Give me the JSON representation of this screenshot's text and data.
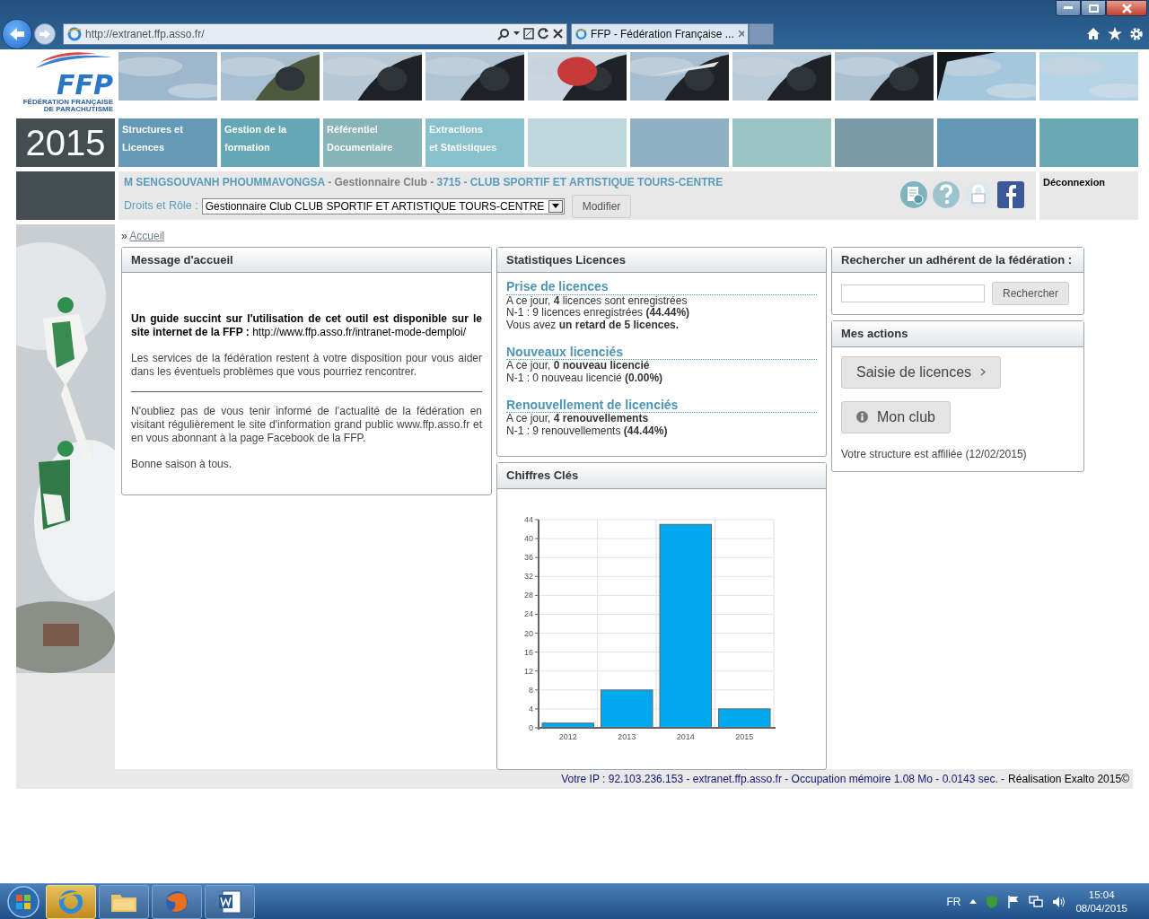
{
  "browser": {
    "address": "http://extranet.ffp.asso.fr/",
    "tab_title": "FFP - Fédération Française ..."
  },
  "header": {
    "logo_letters": "FFP",
    "logo_subtitle": [
      "FÉDÉRATION FRANÇAISE",
      "DE PARACHUTISME"
    ],
    "year": "2015"
  },
  "nav_tiles": [
    {
      "lines": [
        "Structures et",
        "Licences"
      ],
      "color": "#6699b5"
    },
    {
      "lines": [
        "Gestion de la",
        "formation"
      ],
      "color": "#66a7b5"
    },
    {
      "lines": [
        "Référentiel",
        "Documentaire"
      ],
      "color": "#88b3b7"
    },
    {
      "lines": [
        "Extractions",
        "et Statistiques"
      ],
      "color": "#88c0cc"
    },
    {
      "color": "#bed7da"
    },
    {
      "color": "#8fb0c0"
    },
    {
      "color": "#99c4c2"
    },
    {
      "color": "#7b9aa8"
    },
    {
      "color": "#6598b6"
    },
    {
      "color": "#68a9b3"
    }
  ],
  "user_bar": {
    "name": "M SENGSOUVANH PHOUMMAVONGSA",
    "role": "- Gestionnaire Club -",
    "club": "3715 - CLUB SPORTIF ET ARTISTIQUE TOURS-CENTRE",
    "rights_label": "Droits et Rôle :",
    "rights_value": "Gestionnaire Club CLUB SPORTIF ET ARTISTIQUE TOURS-CENTRE",
    "modify_button": "Modifier",
    "logout": "Déconnexion"
  },
  "breadcrumb": {
    "separator": "»",
    "items": [
      "Accueil"
    ]
  },
  "welcome_panel": {
    "title": "Message d'accueil",
    "blocks": [
      {
        "kind": "text",
        "text": "**Un guide succint sur l'utilisation de cet outil est disponible sur le site internet de la FFP :** http://www.ffp.asso.fr/intranet-mode-demploi/"
      },
      {
        "kind": "text",
        "text": "Les services de la fédération restent à votre disposition pour vous aider dans les éventuels problèmes que vous pourriez rencontrer."
      },
      {
        "kind": "divider"
      },
      {
        "kind": "text",
        "text": "N'oubliez pas de vous tenir informé de l’actualité de la fédération en visitant régulièrement le site d'information grand public www.ffp.asso.fr  et en vous abonnant à la page Facebook de la FFP."
      },
      {
        "kind": "text",
        "text": "Bonne saison à tous."
      }
    ]
  },
  "stats_panel": {
    "title": "Statistiques Licences",
    "sections": [
      {
        "title": "Prise de licences",
        "lines": [
          "A ce jour, **4** licences sont enregistrées",
          "N-1 : 9 licences enregistrées **(44.44%)**",
          "Vous avez **un retard de 5 licences.**"
        ]
      },
      {
        "title": "Nouveaux licenciés",
        "lines": [
          "A ce jour, **0 nouveau licencié**",
          "N-1 : 0 nouveau licencié **(0.00%)**"
        ]
      },
      {
        "title": "Renouvellement de licenciés",
        "lines": [
          "A ce jour, **4 renouvellements**",
          "N-1 : 9 renouvellements **(44.44%)**"
        ]
      }
    ]
  },
  "chart_panel": {
    "title": "Chiffres Clés",
    "chart_data": {
      "type": "bar",
      "categories": [
        "2012",
        "2013",
        "2014",
        "2015"
      ],
      "series": [
        {
          "color": "#00a8ef",
          "values": [
            1,
            8,
            43,
            4
          ]
        }
      ],
      "grid": true,
      "ylim": [
        0,
        44
      ],
      "yticks": [
        0,
        4,
        8,
        12,
        16,
        20,
        24,
        28,
        32,
        36,
        40,
        44
      ]
    }
  },
  "search_panel": {
    "title": "Rechercher un adhérent de la fédération :",
    "button": "Rechercher"
  },
  "actions_panel": {
    "title": "Mes actions",
    "buttons": [
      {
        "label": "Saisie de licences",
        "kind": "next"
      },
      {
        "label": "Mon club",
        "kind": "info"
      }
    ],
    "note": "Votre structure est affiliée (12/02/2015)"
  },
  "footer": {
    "text": "Votre IP : 92.103.236.153 - extranet.ffp.asso.fr - Occupation mémoire 1.08 Mo - 0.0143 sec. -",
    "credit": "Réalisation Exalto 2015©"
  },
  "taskbar": {
    "language": "FR",
    "time": "15:04",
    "date": "08/04/2015"
  }
}
